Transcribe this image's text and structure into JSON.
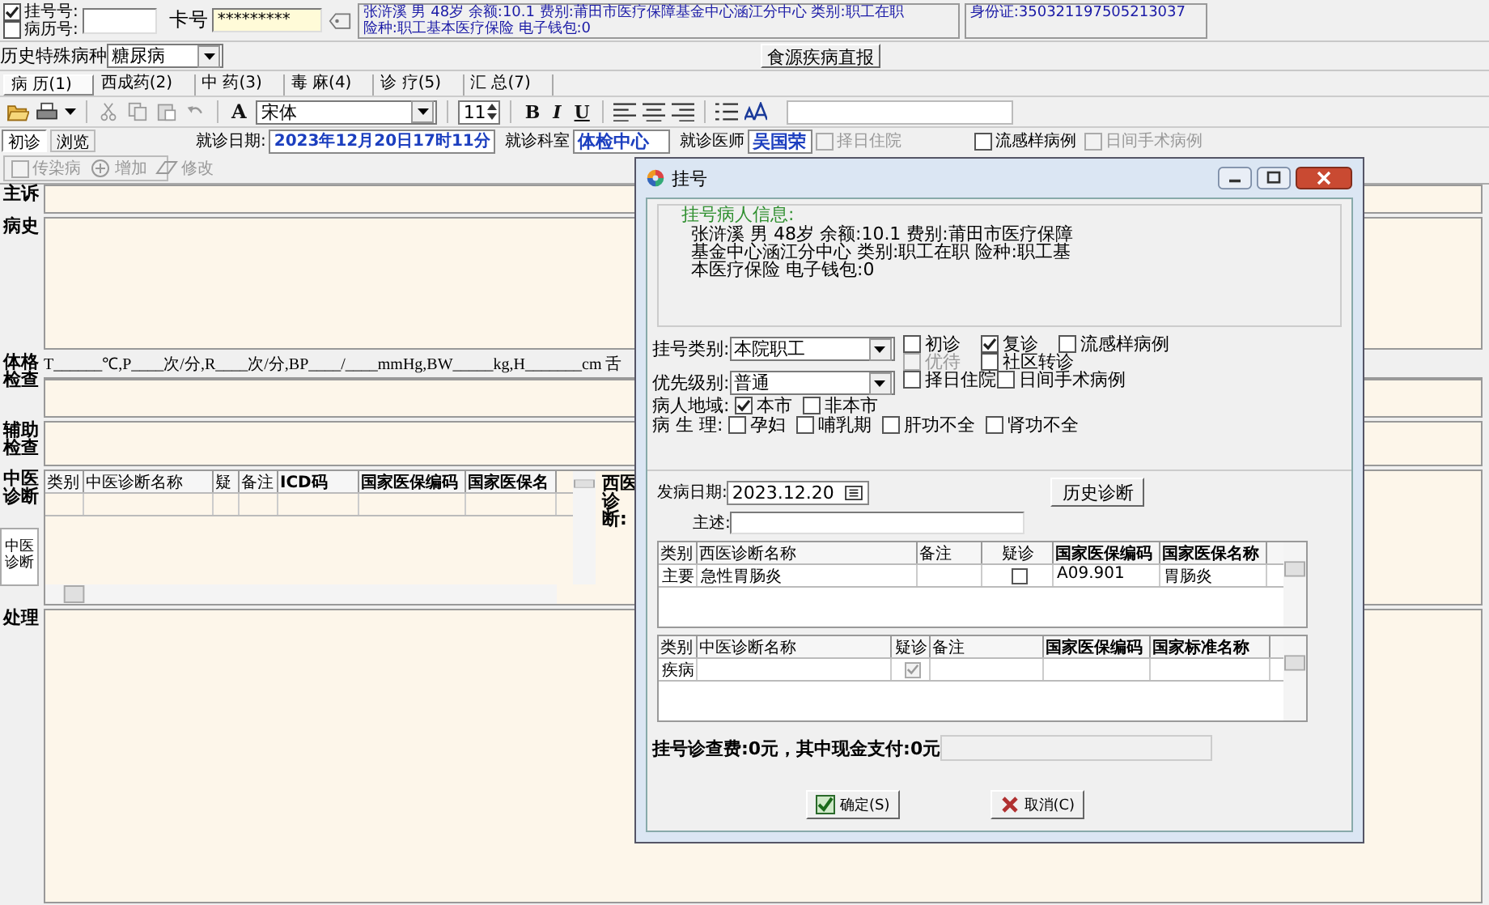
{
  "header": {
    "options": [
      {
        "label": "挂号号:",
        "checked": true
      },
      {
        "label": "病历号:",
        "checked": false
      }
    ],
    "card_label": "卡号",
    "card_value": "*********",
    "patient_info": [
      "张浒溪 男 48岁 余额:10.1 费别:莆田市医疗保障基金中心涵江分中心 类别:职工在职",
      "险种:职工基本医疗保险 电子钱包:0"
    ],
    "id_card": "身份证:350321197505213037"
  },
  "special_disease": {
    "label": "历史特殊病种",
    "value": "糖尿病"
  },
  "report_button": "食源疾病直报",
  "tabs": [
    {
      "label": "病 历(1)",
      "selected": true
    },
    {
      "label": "西成药(2)",
      "selected": false
    },
    {
      "label": "中 药(3)",
      "selected": false
    },
    {
      "label": "毒 麻(4)",
      "selected": false
    },
    {
      "label": "诊 疗(5)",
      "selected": false
    },
    {
      "label": "汇 总(7)",
      "selected": false
    }
  ],
  "toolbar": {
    "font_icon": "A",
    "font": "宋体",
    "size": "11",
    "format": [
      "B",
      "I",
      "U"
    ]
  },
  "visit": {
    "buttons": [
      {
        "label": "初诊",
        "selected": true
      },
      {
        "label": "浏览",
        "selected": false
      }
    ],
    "date_label": "就诊日期:",
    "date": "2023年12月20日17时11分",
    "dept_label": "就诊科室",
    "dept": "体检中心",
    "doctor_label": "就诊医师",
    "doctor": "吴国荣",
    "options": [
      {
        "label": "择日住院",
        "checked": false,
        "disabled": true
      },
      {
        "label": "流感样病例",
        "checked": false,
        "disabled": false
      },
      {
        "label": "日间手术病例",
        "checked": false,
        "disabled": true
      }
    ]
  },
  "record_actions": {
    "infectious": {
      "label": "传染病",
      "checked": false
    },
    "buttons": [
      "增加",
      "修改"
    ]
  },
  "record": {
    "complaint_label": "主诉",
    "history_label": "病史",
    "exam_label": "体格检查",
    "exam_template": "T______℃,P____次/分,R____次/分,BP____/____mmHg,BW_____kg,H_______cm 舌",
    "aux_label": "辅助检查",
    "tcm_label": "中医诊断",
    "tcm_columns": [
      "类别",
      "中医诊断名称",
      "疑",
      "备注",
      "ICD码",
      "国家医保编码",
      "国家医保名"
    ],
    "tcm_side_tab": "中医诊断",
    "western_label": "西医诊断:",
    "treatment_label": "处理"
  },
  "dialog": {
    "title": "挂号",
    "info_title": "挂号病人信息:",
    "info_lines": [
      "张浒溪 男 48岁 余额:10.1 费别:莆田市医疗保障",
      "基金中心涵江分中心 类别:职工在职 险种:职工基",
      "本医疗保险 电子钱包:0"
    ],
    "reg_type_label": "挂号类别:",
    "reg_type": "本院职工",
    "priority_label": "优先级别:",
    "priority": "普通",
    "visit_options": [
      {
        "label": "初诊",
        "checked": false,
        "disabled": false
      },
      {
        "label": "复诊",
        "checked": true,
        "disabled": false
      },
      {
        "label": "流感样病例",
        "checked": false,
        "disabled": false
      },
      {
        "label": "优待",
        "checked": false,
        "disabled": true
      },
      {
        "label": "社区转诊",
        "checked": false,
        "disabled": false
      },
      {
        "label": "择日住院",
        "checked": false,
        "disabled": false
      },
      {
        "label": "日间手术病例",
        "checked": false,
        "disabled": false
      }
    ],
    "region_label": "病人地域:",
    "regions": [
      {
        "label": "本市",
        "checked": true
      },
      {
        "label": "非本市",
        "checked": false
      }
    ],
    "physio_label": "病 生 理:",
    "physio": [
      {
        "label": "孕妇",
        "checked": false
      },
      {
        "label": "哺乳期",
        "checked": false
      },
      {
        "label": "肝功不全",
        "checked": false
      },
      {
        "label": "肾功不全",
        "checked": false
      }
    ],
    "onset_label": "发病日期:",
    "onset": "2023.12.20",
    "history_button": "历史诊断",
    "statement_label": "主述:",
    "western_columns": [
      "类别",
      "西医诊断名称",
      "备注",
      "疑诊",
      "国家医保编码",
      "国家医保名称"
    ],
    "western_rows": [
      {
        "type": "主要",
        "name": "急性胃肠炎",
        "suspected": false,
        "code": "A09.901",
        "insurance_name": "胃肠炎"
      }
    ],
    "tcm_columns": [
      "类别",
      "中医诊断名称",
      "疑诊",
      "备注",
      "国家医保编码",
      "国家标准名称"
    ],
    "tcm_rows": [
      {
        "type": "疾病",
        "suspected": true
      }
    ],
    "fee": "挂号诊查费:0元，其中现金支付:0元",
    "buttons": [
      {
        "kind": "ok",
        "label": "确定(S)"
      },
      {
        "kind": "cancel",
        "label": "取消(C)"
      }
    ]
  }
}
